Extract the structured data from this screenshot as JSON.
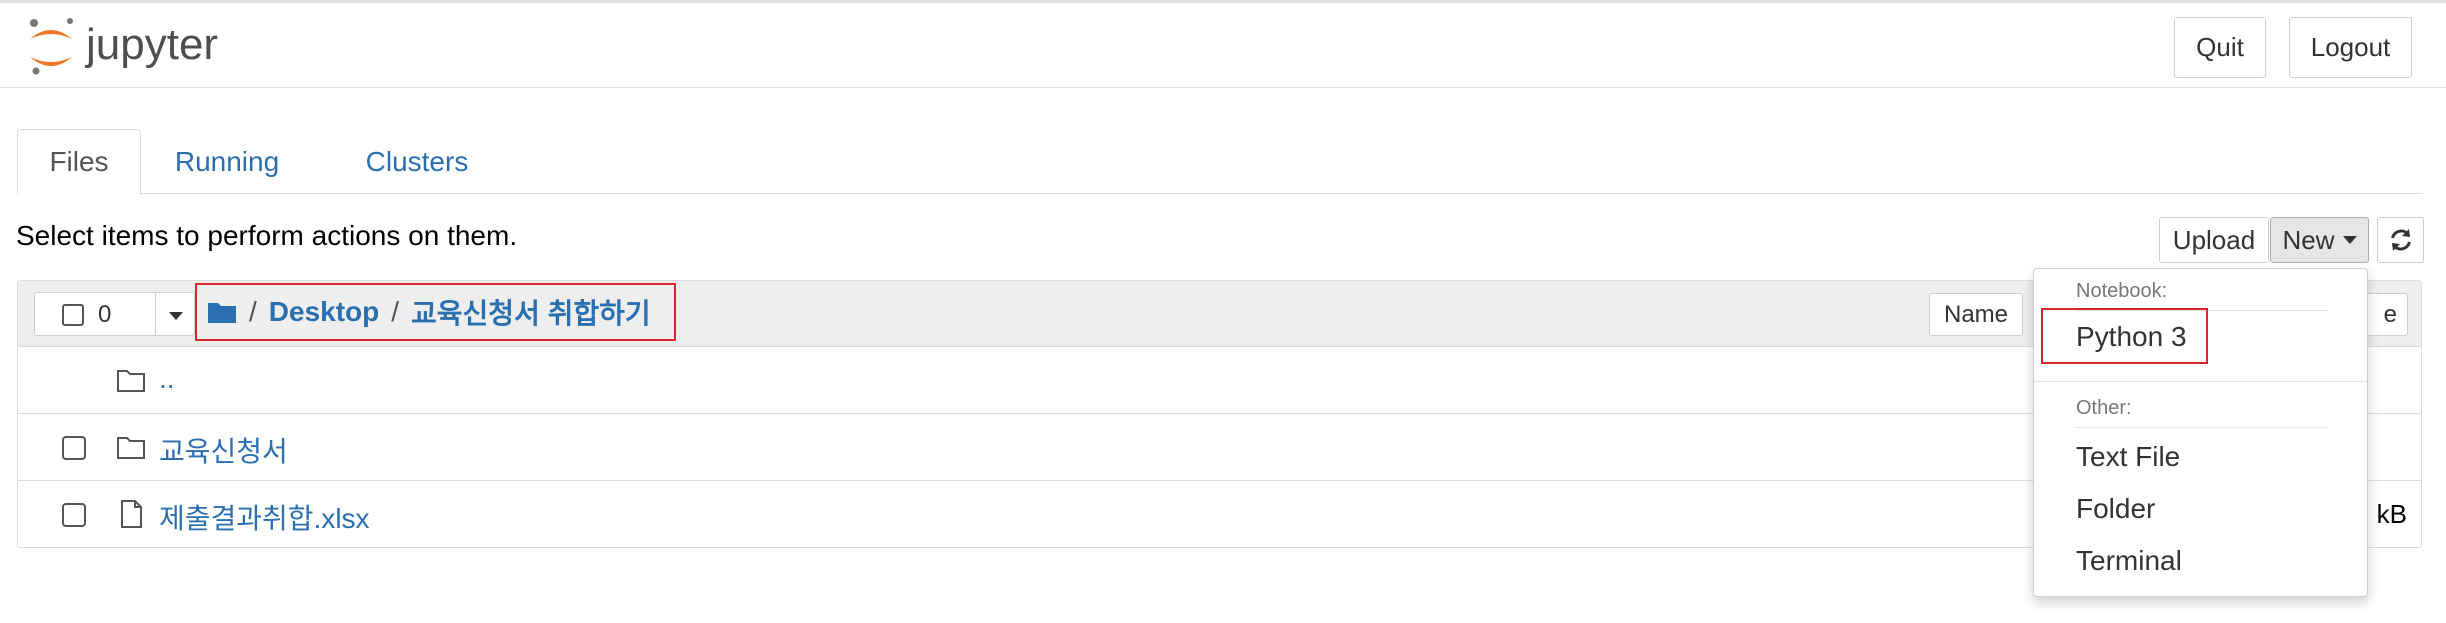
{
  "header": {
    "logo_text": "jupyter",
    "quit_label": "Quit",
    "logout_label": "Logout"
  },
  "tabs": [
    {
      "label": "Files",
      "active": true
    },
    {
      "label": "Running",
      "active": false
    },
    {
      "label": "Clusters",
      "active": false
    }
  ],
  "instructions": "Select items to perform actions on them.",
  "toolbar": {
    "upload_label": "Upload",
    "new_label": "New",
    "refresh_icon": "refresh-icon"
  },
  "list": {
    "selected_count": "0",
    "breadcrumb": {
      "root_sep": "/",
      "items": [
        "Desktop",
        "교육신청서 취합하기"
      ]
    },
    "sort_name_label": "Name",
    "sort_size_partial": "e",
    "rows": [
      {
        "type": "parent",
        "name": "..",
        "icon": "folder-icon",
        "meta": ""
      },
      {
        "type": "folder",
        "name": "교육신청서",
        "icon": "folder-icon",
        "meta": ""
      },
      {
        "type": "file",
        "name": "제출결과취합.xlsx",
        "icon": "file-icon",
        "meta": "kB"
      }
    ]
  },
  "new_menu": {
    "notebook_header": "Notebook:",
    "notebook_items": [
      "Python 3"
    ],
    "other_header": "Other:",
    "other_items": [
      "Text File",
      "Folder",
      "Terminal"
    ]
  },
  "colors": {
    "link": "#2a6fb0",
    "highlight_box": "#d9262c",
    "logo_orange": "#f37726"
  }
}
